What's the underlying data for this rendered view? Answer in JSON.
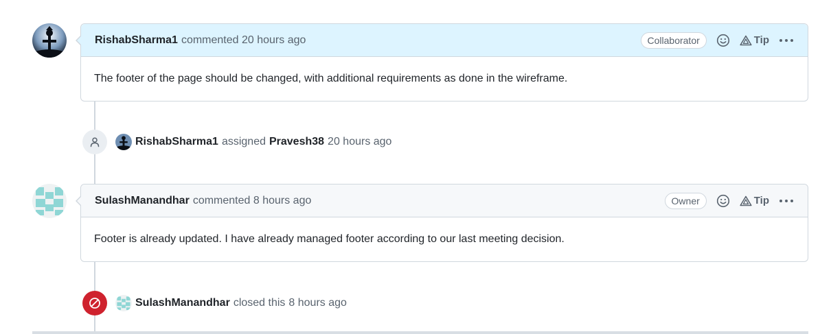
{
  "comments": [
    {
      "author": "RishabSharma1",
      "meta": "commented 20 hours ago",
      "role": "Collaborator",
      "tip_label": "Tip",
      "body": "The footer of the page should be changed, with additional requirements as done in the wireframe.",
      "header_color": "#ddf4ff"
    },
    {
      "author": "SulashManandhar",
      "meta": "commented 8 hours ago",
      "role": "Owner",
      "tip_label": "Tip",
      "body": "Footer is already updated. I have already managed footer according to our last meeting decision.",
      "header_color": "#f6f8fa"
    }
  ],
  "events": [
    {
      "actor": "RishabSharma1",
      "action": "assigned",
      "target": "Pravesh38",
      "time": "20 hours ago",
      "icon": "person-icon",
      "badge_color": "#eaeef2"
    },
    {
      "actor": "SulashManandhar",
      "action": "closed this",
      "time": "8 hours ago",
      "icon": "skip-icon",
      "badge_color": "#cf222e"
    }
  ]
}
